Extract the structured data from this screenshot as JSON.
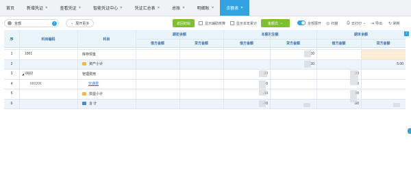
{
  "tabs": [
    {
      "label": "首页",
      "closable": false,
      "active": false
    },
    {
      "label": "新增凭证",
      "closable": true,
      "active": false
    },
    {
      "label": "查看凭证",
      "closable": true,
      "active": false
    },
    {
      "label": "智能凭证中心",
      "closable": true,
      "active": false
    },
    {
      "label": "凭证汇总表",
      "closable": true,
      "active": false
    },
    {
      "label": "总账",
      "closable": true,
      "active": false
    },
    {
      "label": "明细账",
      "closable": true,
      "active": false
    },
    {
      "label": "余额表",
      "closable": true,
      "active": true
    }
  ],
  "toolbar": {
    "scope_value": "全部",
    "expand_label": "展开更多",
    "return_label": "返回初始",
    "show_aux_label": "显示辅助核算",
    "show_year_label": "显示本年累计",
    "format_label": "金额式",
    "expand_all_label": "全部展开",
    "scan_label": "扫描",
    "print_label": "去打印",
    "export_label": "导出",
    "refresh_label": "刷新"
  },
  "table": {
    "col_index": "序",
    "col_code": "科目编码",
    "col_name": "科目",
    "group_opening": "期初余额",
    "group_current": "本期发生额",
    "group_closing": "期末余额",
    "debit_label": "借方金额",
    "credit_label": "贷方金额",
    "rows": [
      {
        "index": "1",
        "code": "1001",
        "name": "库存现金",
        "icon": "none",
        "cur_credit": ".00",
        "close_credit": "",
        "cur_debit": "",
        "close_debit": ""
      },
      {
        "index": "2",
        "code": "",
        "name": "资产小计",
        "icon": "folder-yellow",
        "cur_credit": ".00",
        "close_credit": "5.00",
        "cur_debit": "",
        "close_debit": ""
      },
      {
        "index": "3",
        "code": "6602",
        "name": "管理费用",
        "icon": "none",
        "cur_debit": ".00",
        "close_debit": ".00",
        "cur_credit": "",
        "close_credit": ""
      },
      {
        "index": "4",
        "code": "660206",
        "name": "交通费",
        "icon": "none",
        "cur_debit": "0",
        "close_debit": "0",
        "cur_credit": "",
        "close_credit": ""
      },
      {
        "index": "5",
        "code": "",
        "name": "损益小计",
        "icon": "folder-yellow",
        "cur_debit": ".00",
        "close_debit": "00",
        "cur_credit": "",
        "close_credit": ""
      },
      {
        "index": "6",
        "code": "",
        "name": "合 计",
        "icon": "folder-blue",
        "cur_debit": ".00",
        "close_debit": ".00",
        "cur_credit": "",
        "close_credit": ""
      }
    ]
  }
}
